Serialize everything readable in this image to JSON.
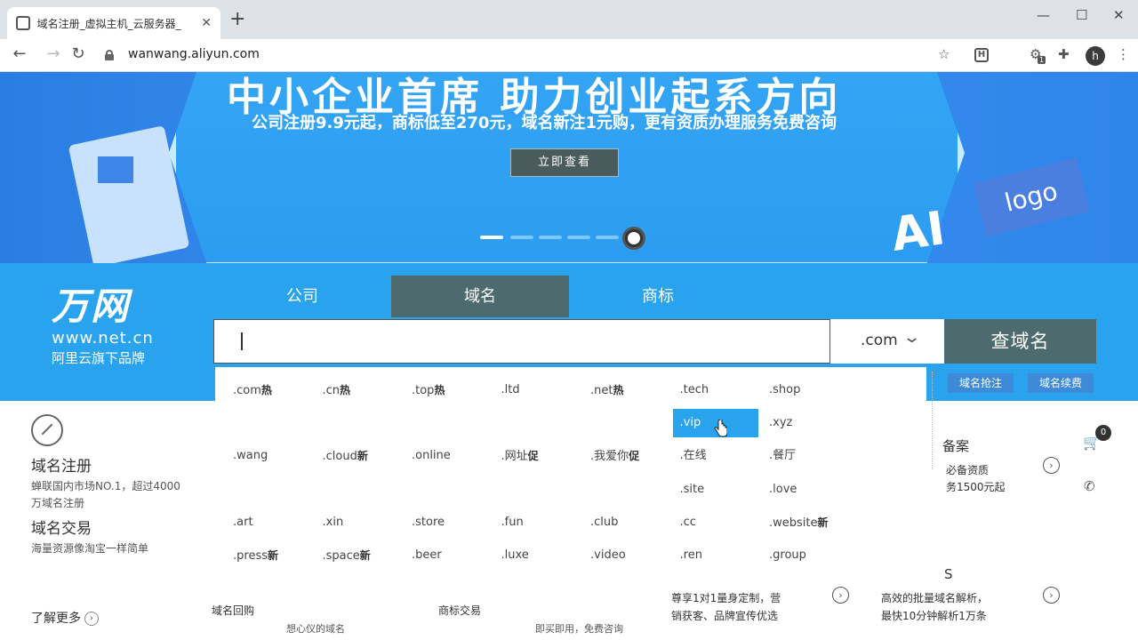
{
  "browser": {
    "tab_title": "域名注册_虚拟主机_云服务器_ ",
    "tab_close": "✕",
    "new_tab": "+",
    "url": "wanwang.aliyun.com",
    "avatar_letter": "h",
    "ext_letter": "H",
    "ext_badge": "1",
    "minimize": "—",
    "maximize": "☐",
    "close": "✕"
  },
  "banner": {
    "headline": "中小企业首席 助力创业起系方向",
    "subtitle": "公司注册9.9元起，商标低至270元，域名新注1元购，更有资质办理服务免费咨询",
    "cta": "立即查看",
    "ai_text": "AI",
    "logo_text": "logo"
  },
  "brand": {
    "name": "万网",
    "www": "www.net.cn",
    "tagline": "阿里云旗下品牌"
  },
  "search": {
    "tabs": [
      {
        "label": "公司",
        "active": false
      },
      {
        "label": "域名",
        "active": true
      },
      {
        "label": "商标",
        "active": false
      }
    ],
    "input_value": "",
    "suffix": ".com",
    "button": "查域名",
    "links": [
      "域名抢注",
      "域名续费"
    ]
  },
  "dropdown": {
    "rows": [
      [
        {
          "t": ".com",
          "b": "热"
        },
        {
          "t": ".cn",
          "b": "热"
        },
        {
          "t": ".top",
          "b": "热"
        },
        {
          "t": ".ltd",
          "b": ""
        },
        {
          "t": ".net",
          "b": "热"
        },
        {
          "t": ".tech",
          "b": ""
        },
        {
          "t": ".shop",
          "b": ""
        }
      ],
      [
        {
          "t": ".vip",
          "b": "",
          "selected": true
        },
        {
          "t": ".xyz",
          "b": ""
        }
      ],
      [
        {
          "t": ".wang",
          "b": ""
        },
        {
          "t": ".cloud",
          "b": "新"
        },
        {
          "t": ".online",
          "b": ""
        },
        {
          "t": ".网址",
          "b": "促"
        },
        {
          "t": ".我爱你",
          "b": "促"
        },
        {
          "t": ".在线",
          "b": ""
        },
        {
          "t": ".餐厅",
          "b": ""
        }
      ],
      [
        {
          "t": ".site",
          "b": ""
        },
        {
          "t": ".love",
          "b": ""
        }
      ],
      [
        {
          "t": ".art",
          "b": ""
        },
        {
          "t": ".xin",
          "b": ""
        },
        {
          "t": ".store",
          "b": ""
        },
        {
          "t": ".fun",
          "b": ""
        },
        {
          "t": ".club",
          "b": ""
        },
        {
          "t": ".cc",
          "b": ""
        },
        {
          "t": ".website",
          "b": "新"
        }
      ],
      [
        {
          "t": ".press",
          "b": "新"
        },
        {
          "t": ".space",
          "b": "新"
        },
        {
          "t": ".beer",
          "b": ""
        },
        {
          "t": ".luxe",
          "b": ""
        },
        {
          "t": ".video",
          "b": ""
        },
        {
          "t": ".ren",
          "b": ""
        },
        {
          "t": ".group",
          "b": ""
        }
      ]
    ]
  },
  "left_side": {
    "title1": "域名注册",
    "desc1": "蝉联国内市场NO.1，超过4000万域名注册",
    "title2": "域名交易",
    "desc2": "海量资源像淘宝一样简单",
    "learn_more": "了解更多",
    "learn_icon": "›"
  },
  "lower": {
    "buyback": "域名回购",
    "buyback_desc": "想心仪的域名",
    "trademark": "商标交易",
    "trademark_desc": "即买即用，免费咨询",
    "custom_1": "尊享1对1量身定制，营",
    "custom_2": "销获客、品牌宣传优选",
    "dns_1": "高效的批量域名解析，",
    "dns_2": "最快10分钟解析1万条",
    "beian_title": "备案",
    "beian_desc_1": "必备资质",
    "beian_desc_2": "务1500元起",
    "dns_title": "S",
    "cart_count": "0"
  },
  "colors": {
    "band": "#29a3ee",
    "active_tab": "#4d6b6e",
    "selected_item": "#29a3ee"
  }
}
